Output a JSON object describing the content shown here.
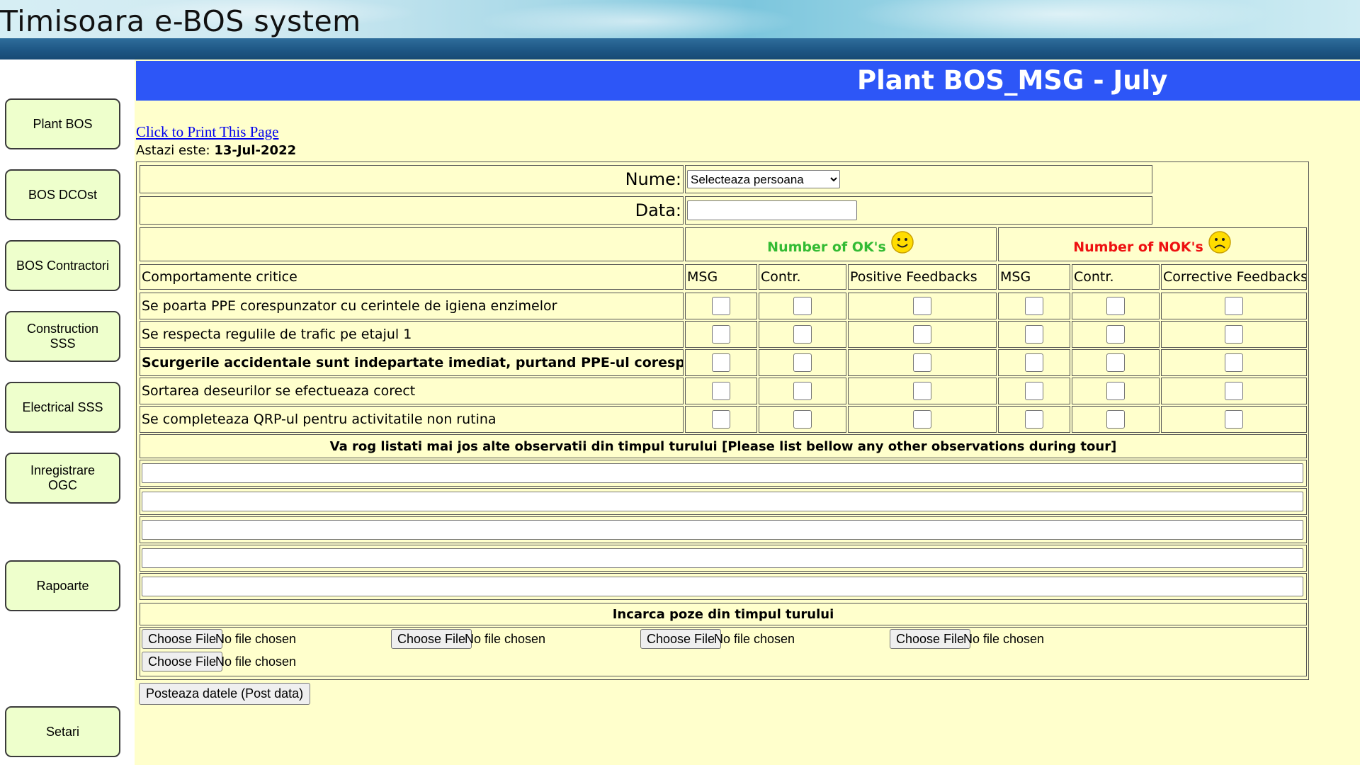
{
  "app_title": "Timisoara e-BOS system",
  "sidebar": {
    "items": [
      {
        "label": "Plant BOS"
      },
      {
        "label": "BOS DCOst"
      },
      {
        "label": "BOS Contractori"
      },
      {
        "label": "Construction\nSSS"
      },
      {
        "label": "Electrical SSS"
      },
      {
        "label": "Inregistrare\nOGC"
      },
      {
        "label": "Rapoarte"
      },
      {
        "label": "Setari"
      }
    ]
  },
  "page_title": "Plant BOS_MSG - July",
  "print_link": "Click to Print This Page",
  "today": {
    "label": "Astazi este:",
    "value": "13-Jul-2022"
  },
  "form": {
    "nume_label": "Nume:",
    "nume_select": "Selecteaza persoana",
    "data_label": "Data:",
    "data_value": "",
    "ok_header": "Number of OK's",
    "nok_header": "Number of NOK's",
    "ok_color": "#33bb33",
    "nok_color": "#ee1111",
    "columns": {
      "behaviour": "Comportamente critice",
      "ok_msg": "MSG",
      "ok_contr": "Contr.",
      "ok_feedback": "Positive Feedbacks",
      "nok_msg": "MSG",
      "nok_contr": "Contr.",
      "nok_feedback": "Corrective Feedbacks"
    },
    "rows": [
      {
        "text": "Se poarta PPE corespunzator cu cerintele de igiena enzimelor",
        "bold": false
      },
      {
        "text": "Se respecta regulile de trafic pe etajul 1",
        "bold": false
      },
      {
        "text": "Scurgerile accidentale sunt indepartate imediat, purtand PPE-ul corespunzator",
        "bold": true
      },
      {
        "text": "Sortarea deseurilor se efectueaza corect",
        "bold": false
      },
      {
        "text": "Se completeaza QRP-ul pentru activitatile non rutina",
        "bold": false
      }
    ],
    "observations_header": "Va rog listati mai jos alte observatii din timpul turului [Please list bellow any other observations during tour]",
    "observations": [
      "",
      "",
      "",
      "",
      ""
    ],
    "photos_header": "Incarca poze din timpul turului",
    "file_inputs": [
      {
        "button": "Choose File",
        "status": "No file chosen"
      },
      {
        "button": "Choose File",
        "status": "No file chosen"
      },
      {
        "button": "Choose File",
        "status": "No file chosen"
      },
      {
        "button": "Choose File",
        "status": "No file chosen"
      },
      {
        "button": "Choose File",
        "status": "No file chosen"
      }
    ],
    "post_button": "Posteaza datele (Post data)"
  }
}
